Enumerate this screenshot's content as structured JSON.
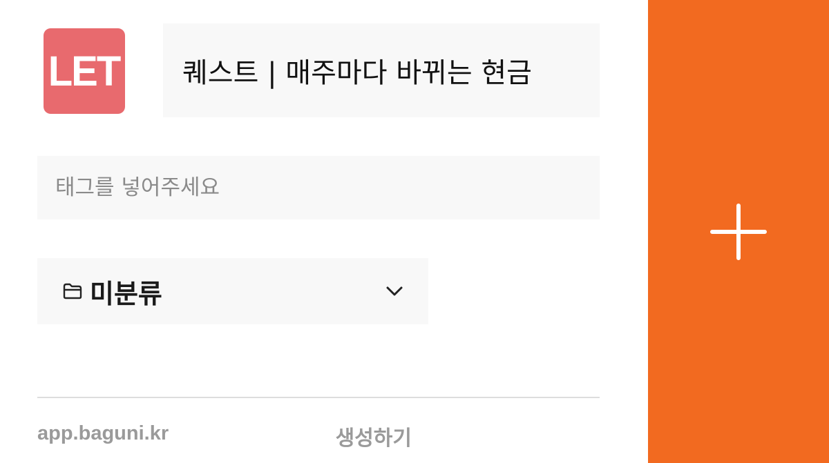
{
  "favicon": {
    "text": "LET",
    "color": "#e86a6e"
  },
  "title_field": {
    "value": "퀘스트 | 매주마다 바뀌는 현금"
  },
  "tag_field": {
    "placeholder": "태그를 넣어주세요"
  },
  "folder_select": {
    "icon": "folder-icon",
    "selected": "미분류",
    "chevron": "chevron-down-icon"
  },
  "footer": {
    "url": "app.baguni.kr",
    "create_label": "생성하기"
  },
  "add_panel": {
    "icon": "plus-icon",
    "color": "#f26a20"
  }
}
